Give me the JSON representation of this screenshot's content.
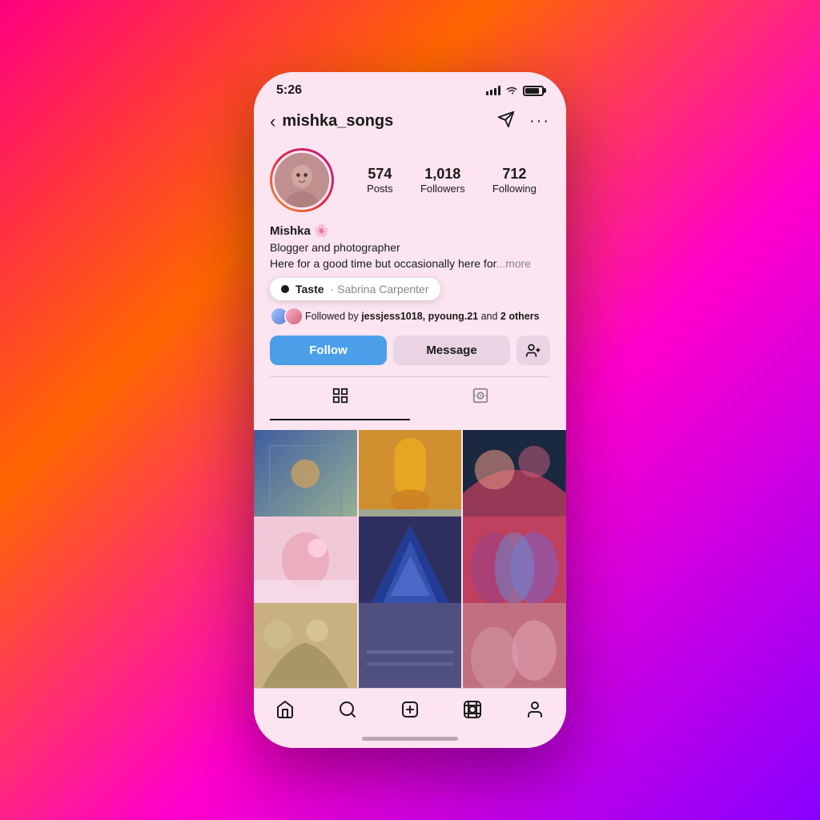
{
  "background": {
    "gradient_start": "#ff0080",
    "gradient_end": "#8800ff"
  },
  "status_bar": {
    "time": "5:26"
  },
  "nav": {
    "back_label": "‹",
    "username": "mishka_songs",
    "send_icon": "send",
    "more_icon": "more"
  },
  "profile": {
    "name": "Mishka 🌸",
    "bio_line1": "Blogger and photographer",
    "bio_line2": "Here for a good time but occasionally here for",
    "bio_more": "...more",
    "stats": {
      "posts_count": "574",
      "posts_label": "Posts",
      "followers_count": "1,018",
      "followers_label": "Followers",
      "following_count": "712",
      "following_label": "Following"
    },
    "music": {
      "song": "Taste",
      "artist": "Sabrina Carpenter"
    },
    "followed_by": {
      "text": "Followed by ",
      "names": "jessjess1018, pyoung.21",
      "suffix": " and ",
      "others": "2 others"
    }
  },
  "buttons": {
    "follow": "Follow",
    "message": "Message",
    "add_friend_icon": "person-add"
  },
  "tabs": {
    "grid_icon": "grid",
    "tagged_icon": "tag"
  },
  "bottom_nav": {
    "items": [
      {
        "icon": "home",
        "label": "Home"
      },
      {
        "icon": "search",
        "label": "Search"
      },
      {
        "icon": "add",
        "label": "Add"
      },
      {
        "icon": "reels",
        "label": "Reels"
      },
      {
        "icon": "profile",
        "label": "Profile"
      }
    ]
  }
}
